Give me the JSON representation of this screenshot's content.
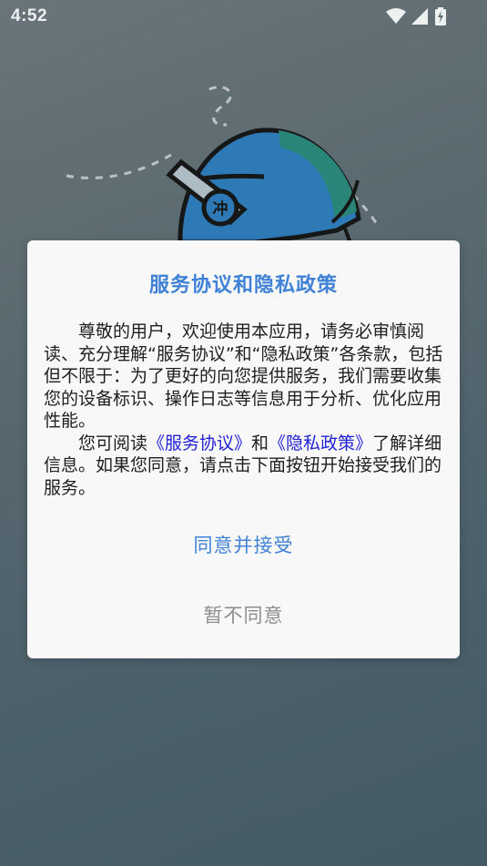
{
  "status_bar": {
    "time": "4:52"
  },
  "hero": {
    "helmet_char": "冲"
  },
  "dialog": {
    "title": "服务协议和隐私政策",
    "para1": "尊敬的用户，欢迎使用本应用，请务必审慎阅读、充分理解“服务协议”和“隐私政策”各条款，包括但不限于：为了更好的向您提供服务，我们需要收集您的设备标识、操作日志等信息用于分析、优化应用性能。",
    "para2_prefix": "您可阅读",
    "service_link": "《服务协议》",
    "para2_middle": "和",
    "privacy_link": "《隐私政策》",
    "para2_suffix": "了解详细信息。如果您同意，请点击下面按钮开始接受我们的服务。",
    "accept_label": "同意并接受",
    "decline_label": "暂不同意"
  },
  "colors": {
    "accent": "#3f82d8",
    "link": "#2121d6",
    "muted": "#8d8d8d"
  },
  "icons": {
    "wifi": "wifi-icon",
    "signal": "signal-icon",
    "battery": "battery-charging-icon"
  }
}
